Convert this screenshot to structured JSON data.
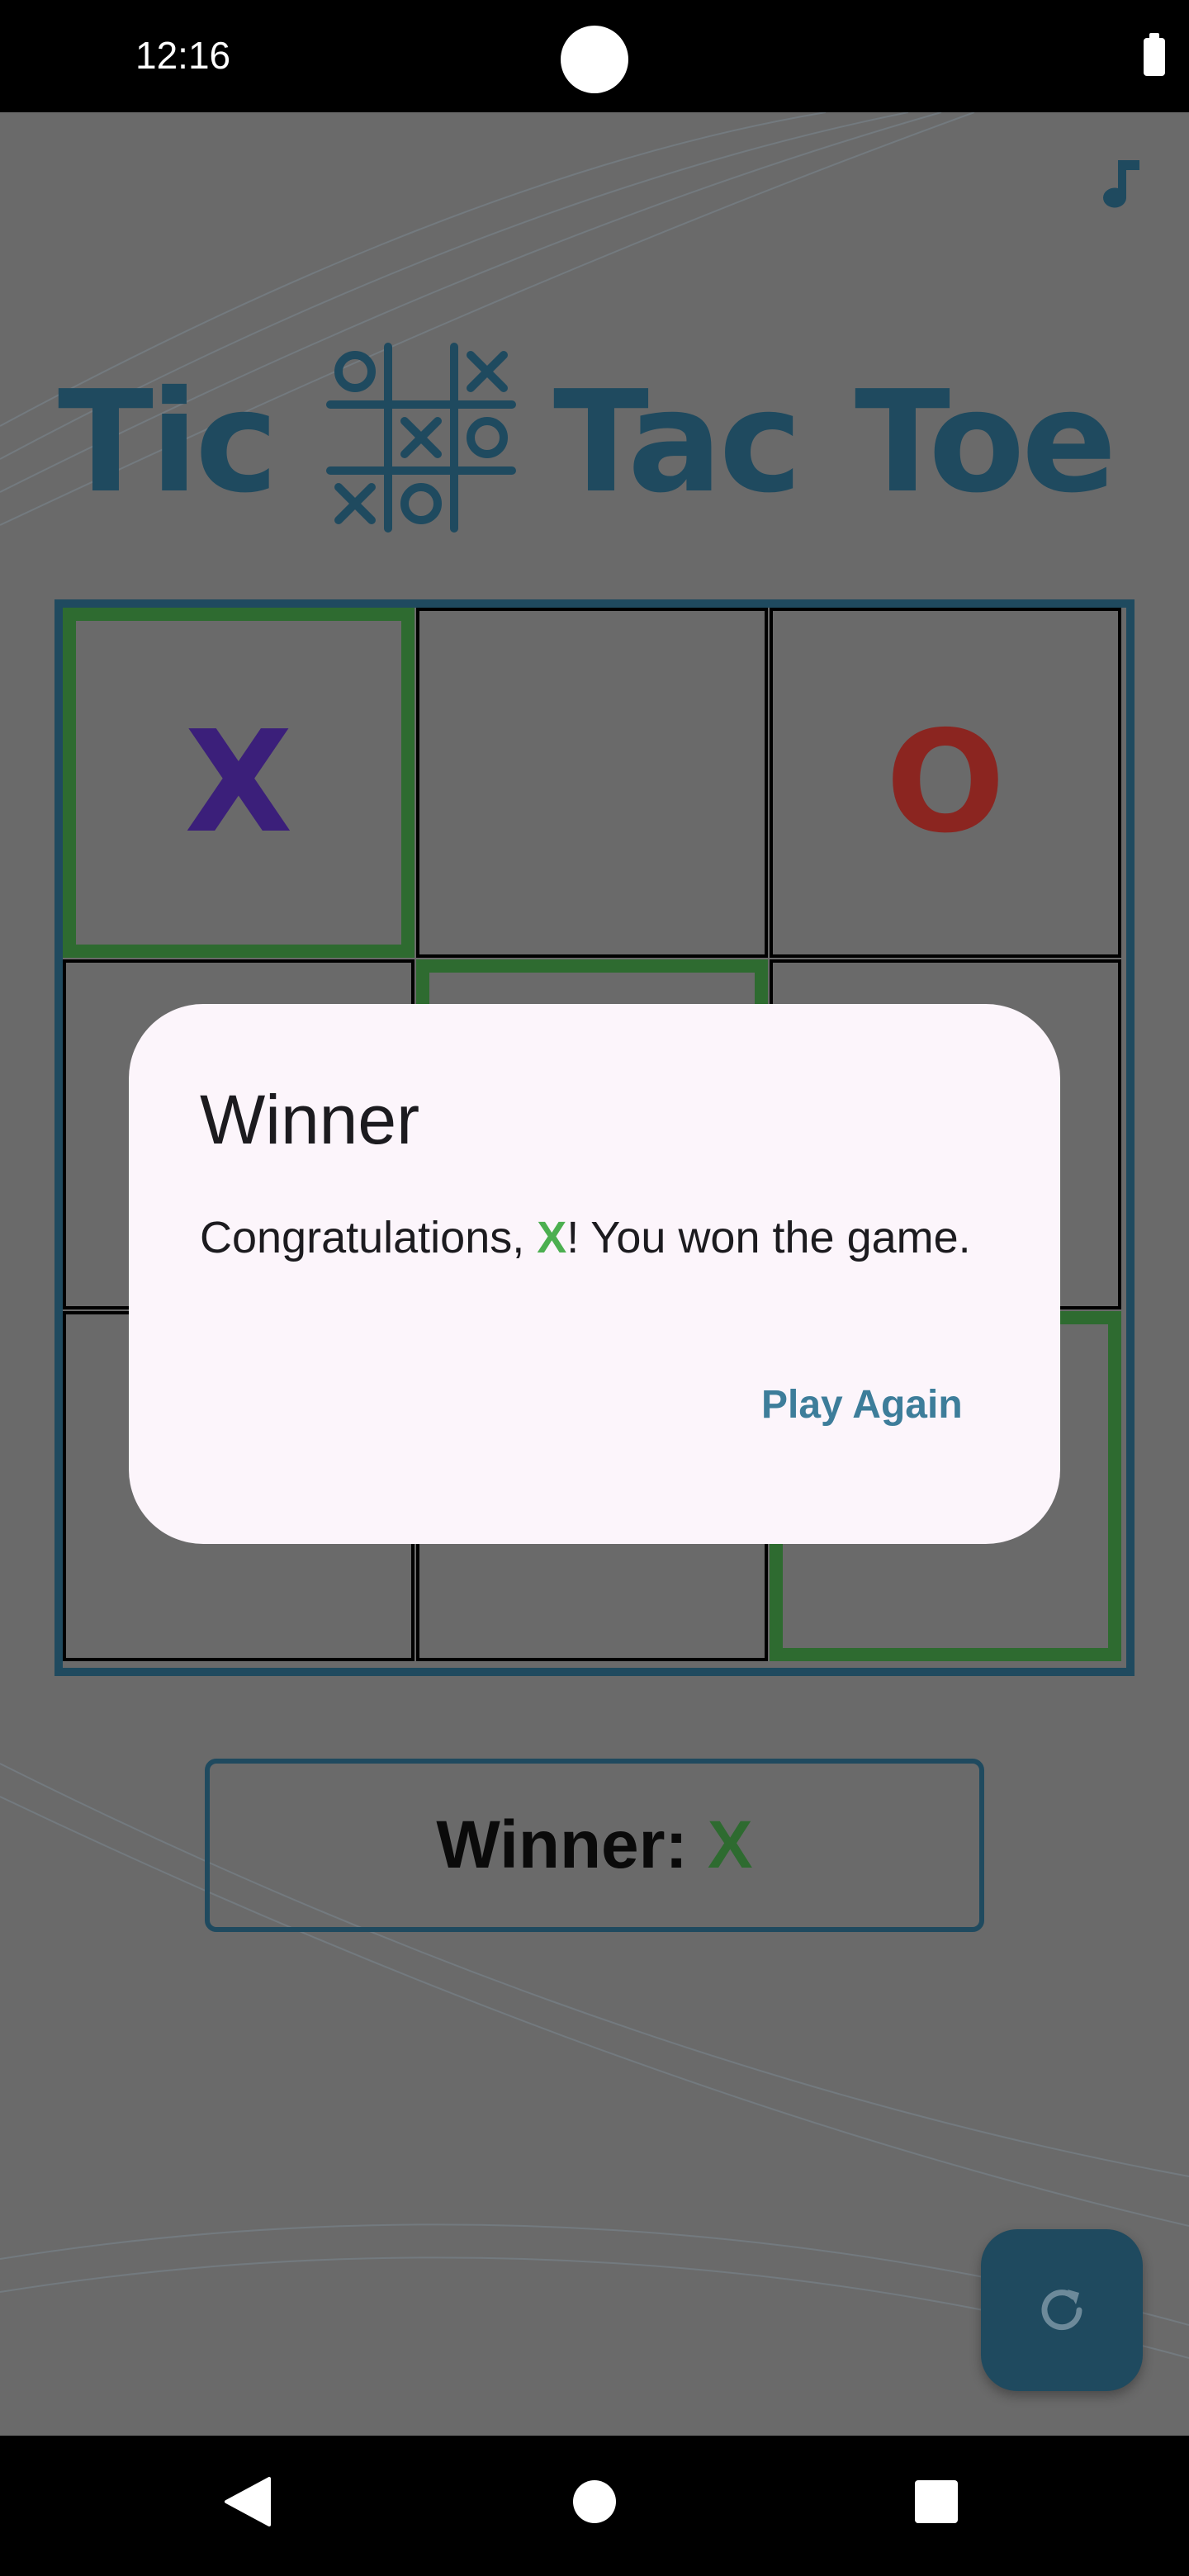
{
  "status_bar": {
    "time": "12:16"
  },
  "title": {
    "word1": "Tic",
    "word2": "Tac",
    "word3": "Toe"
  },
  "board": {
    "cells": [
      {
        "mark": "X",
        "win": true
      },
      {
        "mark": "",
        "win": false
      },
      {
        "mark": "O",
        "win": false
      },
      {
        "mark": "",
        "win": false
      },
      {
        "mark": "",
        "win": true
      },
      {
        "mark": "",
        "win": false
      },
      {
        "mark": "",
        "win": false
      },
      {
        "mark": "",
        "win": false
      },
      {
        "mark": "",
        "win": true
      }
    ]
  },
  "winner_box": {
    "label": "Winner:",
    "player": "X"
  },
  "dialog": {
    "title": "Winner",
    "message_prefix": "Congratulations, ",
    "message_player": "X",
    "message_suffix": "! You won the game.",
    "button": "Play Again"
  },
  "icons": {
    "music": "music-note-icon",
    "reset": "refresh-icon",
    "title": "tic-tac-toe-grid-icon"
  },
  "colors": {
    "accent": "#1f4a5f",
    "win_green": "#2e6b30",
    "x_color": "#3b1f7a",
    "o_color": "#8b2520",
    "dialog_bg": "#fcf5fb",
    "dialog_button": "#3d7d9a"
  }
}
